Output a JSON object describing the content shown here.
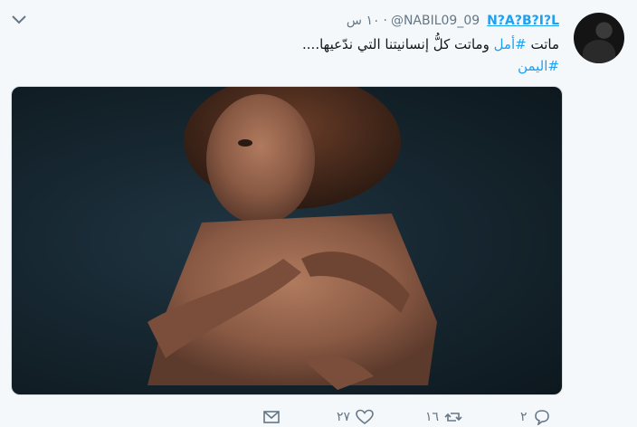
{
  "tweet": {
    "display_name": "N?A?B?I?L",
    "handle": "@NABIL09_09",
    "separator": "·",
    "time": "١٠ س",
    "text_line1_a": "ماتت ",
    "hashtag1": "#أمل",
    "text_line1_b": " وماتت كلُّ إنسانيتنا التي ندّعيها....",
    "hashtag2": "#اليمن",
    "media_description_icon": "photo-icon"
  },
  "actions": {
    "reply_count": "٢",
    "retweet_count": "١٦",
    "like_count": "٢٧"
  },
  "colors": {
    "accent": "#1da1f2",
    "muted": "#657786",
    "text": "#14171a",
    "background": "#f5f8fa"
  }
}
